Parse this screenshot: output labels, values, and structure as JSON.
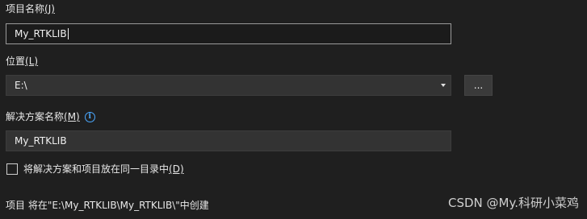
{
  "project_name": {
    "label": "项目名称",
    "hotkey": "(J)",
    "value": "My_RTKLIB"
  },
  "location": {
    "label": "位置",
    "hotkey": "(L)",
    "value": "E:\\",
    "browse_label": "..."
  },
  "solution_name": {
    "label": "解决方案名称",
    "hotkey": "(M)",
    "value": "My_RTKLIB",
    "info_icon": "info-icon"
  },
  "same_directory": {
    "label": "将解决方案和项目放在同一目录中",
    "hotkey": "(D)",
    "checked": false
  },
  "summary": "项目 将在\"E:\\My_RTKLIB\\My_RTKLIB\\\"中创建",
  "watermark": "CSDN @My.科研小菜鸡",
  "colors": {
    "background": "#1f1f1f",
    "info_accent": "#4aa8ff"
  }
}
